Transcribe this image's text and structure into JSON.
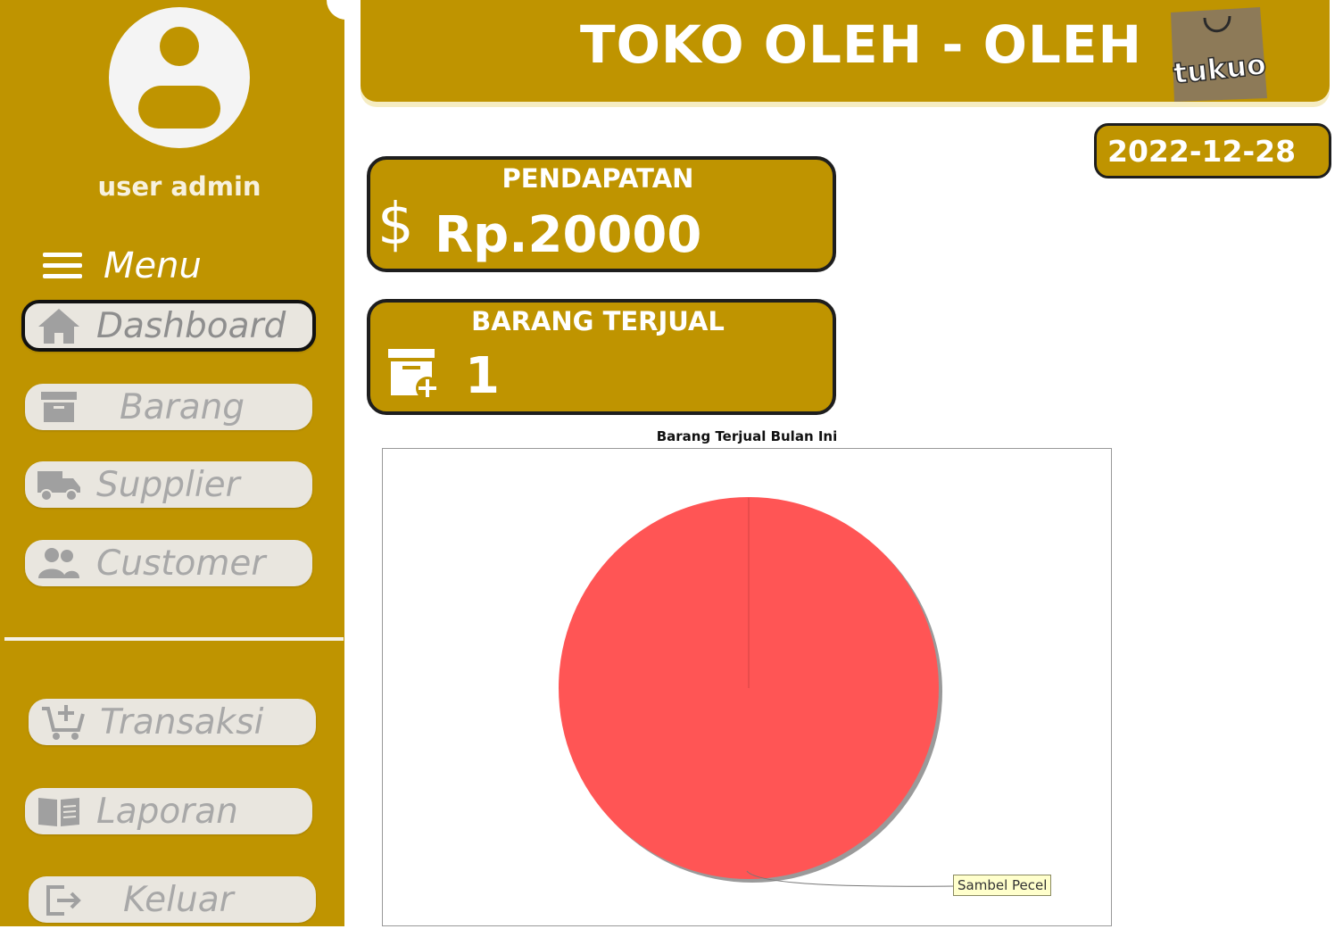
{
  "sidebar": {
    "user_name": "user admin",
    "menu_label": "Menu",
    "items": [
      {
        "label": "Dashboard",
        "icon": "home-icon",
        "active": true
      },
      {
        "label": "Barang",
        "icon": "archive-icon"
      },
      {
        "label": "Supplier",
        "icon": "truck-icon"
      },
      {
        "label": "Customer",
        "icon": "people-icon"
      },
      {
        "label": "Transaksi",
        "icon": "cart-add-icon"
      },
      {
        "label": "Laporan",
        "icon": "book-icon"
      },
      {
        "label": "Keluar",
        "icon": "logout-icon"
      }
    ]
  },
  "header": {
    "title": "TOKO OLEH - OLEH",
    "logo_text": "tukuo"
  },
  "date": "2022-12-28",
  "stats": {
    "revenue": {
      "title": "PENDAPATAN",
      "currency_symbol": "$",
      "value": "Rp.20000"
    },
    "items_sold": {
      "title": "BARANG TERJUAL",
      "value": "1"
    }
  },
  "chart_data": {
    "type": "pie",
    "title": "Barang Terjual Bulan Ini",
    "labels": [
      "Sambel Pecel"
    ],
    "values": [
      1
    ],
    "colors": [
      "#ff5555"
    ]
  },
  "colors": {
    "accent": "#bf9400",
    "button_bg": "#e9e6df",
    "pie_red": "#ff5555"
  }
}
